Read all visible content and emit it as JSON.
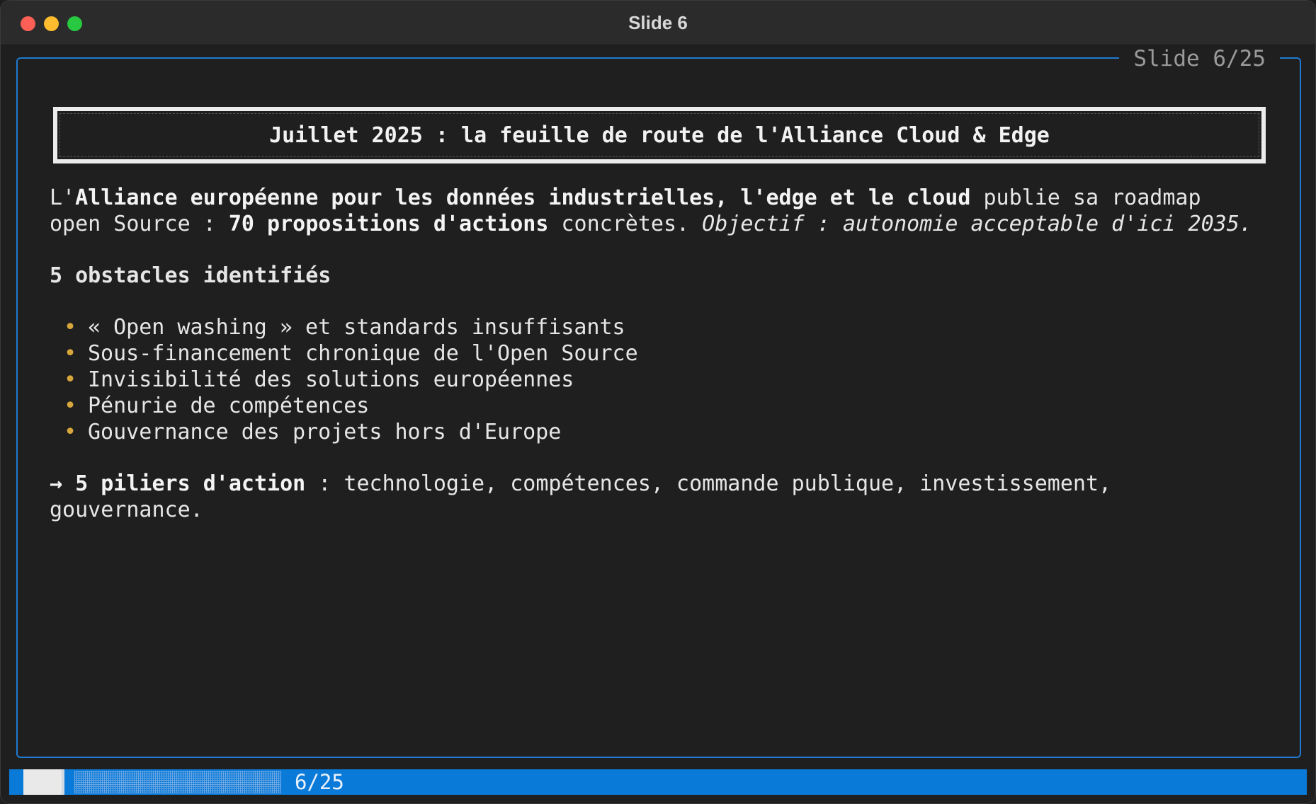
{
  "window": {
    "title": "Slide 6"
  },
  "slide": {
    "counter": "Slide 6/25",
    "title": "Juillet 2025 : la feuille de route de l'Alliance Cloud & Edge",
    "intro": {
      "l1_a": "L'",
      "l1_b": "Alliance européenne pour les données industrielles, l'edge et le cloud",
      "l1_c": " publie sa roadmap",
      "l2_a": "open Source : ",
      "l2_b": "70 propositions d'actions",
      "l2_c": " concrètes. ",
      "l2_d": "Objectif : autonomie acceptable d'ici 2035."
    },
    "obstacles_heading": "5 obstacles identifiés",
    "bullet_symbol": "•",
    "obstacles": [
      "« Open washing » et standards insuffisants",
      "Sous-financement chronique de l'Open Source",
      "Invisibilité des solutions européennes",
      "Pénurie de compétences",
      "Gouvernance des projets hors d'Europe"
    ],
    "pillars": {
      "arrow": "→ ",
      "label": "5 piliers d'action",
      "text_l1": " : technologie, compétences, commande publique, investissement,",
      "text_l2": "gouvernance."
    }
  },
  "status_bar": {
    "progress_text": "6/25",
    "progress_fraction": 0.24
  },
  "colors": {
    "frame": "#1f7ad1",
    "status_bar": "#0a7ad9",
    "bullet": "#d7a63c"
  }
}
